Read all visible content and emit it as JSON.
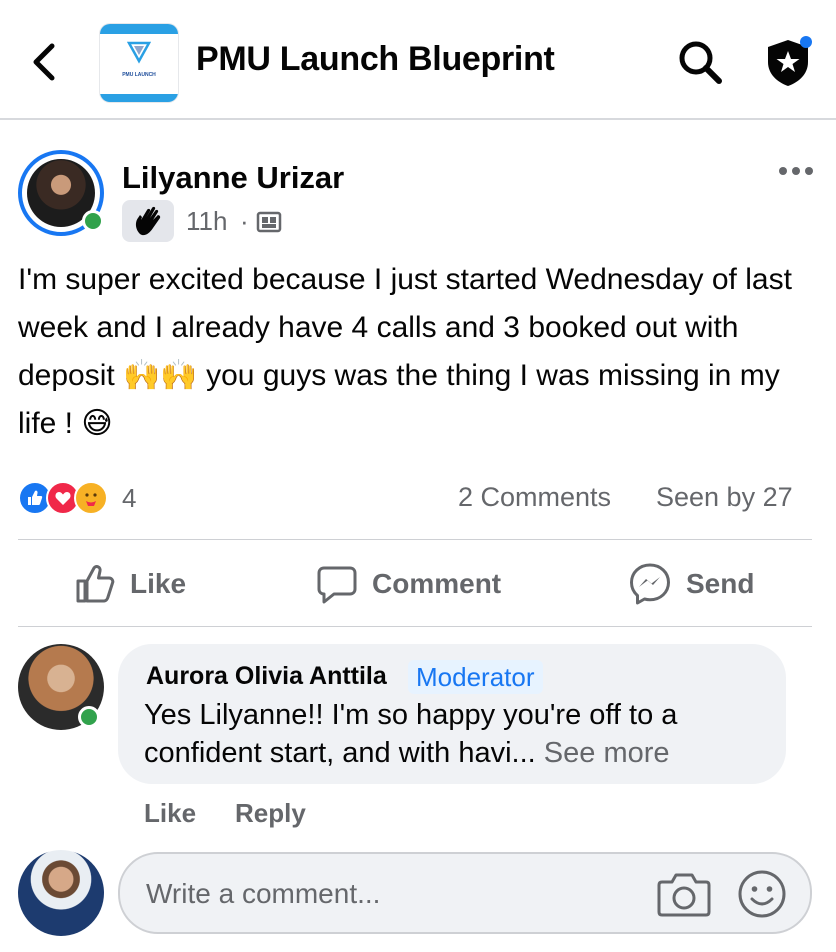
{
  "header": {
    "group_name": "PMU Launch Blueprint",
    "logo_text": "PMU LAUNCH"
  },
  "post": {
    "author": "Lilyanne Urizar",
    "time": "11h",
    "separator": "·",
    "text": "I'm super excited because I just started Wednesday of  last week and I already have 4 calls and 3 booked out with deposit 🙌🙌 you guys was the thing I was missing in my life ! 😅",
    "reactions": [
      "like",
      "love",
      "care"
    ],
    "reaction_count": "4",
    "comments_count": "2 Comments",
    "seen_by": "Seen by 27",
    "actions": {
      "like": "Like",
      "comment": "Comment",
      "send": "Send"
    }
  },
  "comment": {
    "author": "Aurora Olivia Anttila",
    "badge": "Moderator",
    "text": "Yes Lilyanne!! I'm so happy you're off to a confident start, and with havi...",
    "see_more": "See more",
    "like": "Like",
    "reply": "Reply"
  },
  "composer": {
    "placeholder": "Write a comment..."
  },
  "colors": {
    "accent": "#1877f2",
    "online": "#31a24c",
    "secondary_text": "#65676b"
  }
}
